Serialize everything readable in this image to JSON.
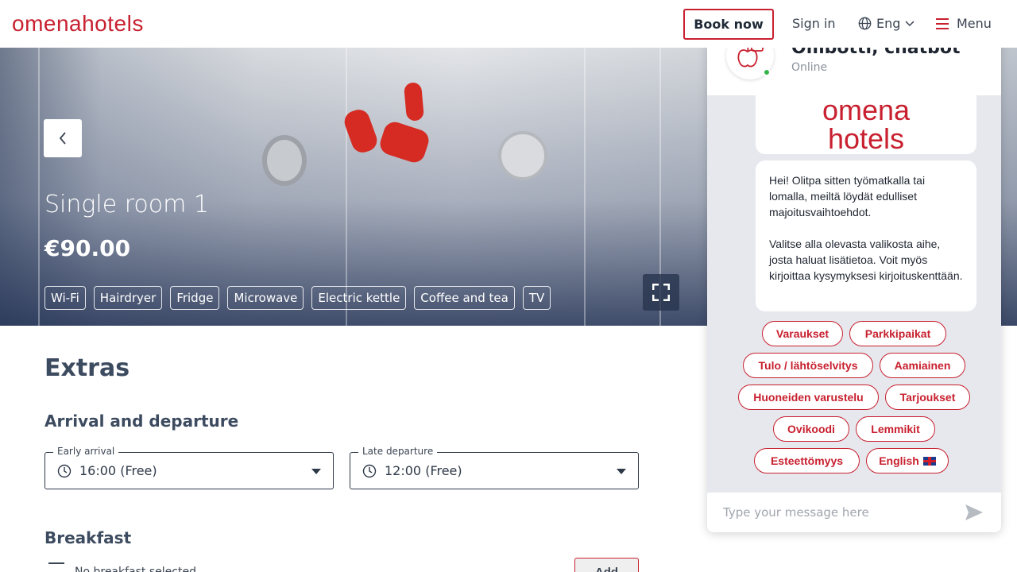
{
  "header": {
    "logo": "omenahotels",
    "book_now": "Book now",
    "sign_in": "Sign in",
    "language": "Eng",
    "menu": "Menu"
  },
  "room": {
    "title": "Single room 1",
    "price": "€90.00",
    "amenities": [
      "Wi-Fi",
      "Hairdryer",
      "Fridge",
      "Microwave",
      "Electric kettle",
      "Coffee and tea",
      "TV"
    ]
  },
  "extras": {
    "title": "Extras",
    "arrival_title": "Arrival and departure",
    "early_arrival": {
      "label": "Early arrival",
      "value": "16:00 (Free)"
    },
    "late_departure": {
      "label": "Late departure",
      "value": "12:00 (Free)"
    },
    "breakfast_title": "Breakfast",
    "breakfast_status": "No breakfast selected",
    "add_label": "Add"
  },
  "chat": {
    "bot_name": "Ombotti, chatbot",
    "status": "Online",
    "logo_line1": "omena",
    "logo_line2": "hotels",
    "message_p1": "Hei! Olitpa sitten työmatkalla tai lomalla, meiltä löydät edulliset majoitusvaihtoehdot.",
    "message_p2": "Valitse alla olevasta valikosta aihe, josta haluat lisätietoa. Voit myös kirjoittaa kysymyksesi kirjoituskenttään.",
    "chips": [
      "Varaukset",
      "Parkkipaikat",
      "Tulo / lähtöselvitys",
      "Aamiainen",
      "Huoneiden varustelu",
      "Tarjoukset",
      "Ovikoodi",
      "Lemmikit",
      "Esteettömyys",
      "English"
    ],
    "input_placeholder": "Type your message here"
  },
  "colors": {
    "brand": "#c8202f",
    "online": "#34b44a"
  }
}
